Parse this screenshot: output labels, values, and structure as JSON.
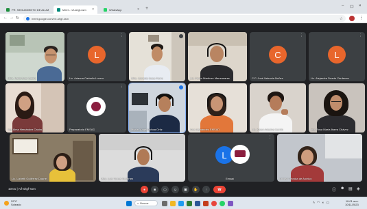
{
  "browser": {
    "tabs": [
      {
        "label": "PR. SEGUIMIENTO DE ALUM",
        "favicon_color": "#1e8e3e",
        "active": false
      },
      {
        "label": "Meet - rvf-ahgf-ssm",
        "favicon_color": "#00897b",
        "active": true
      },
      {
        "label": "WhatsApp",
        "favicon_color": "#25d366",
        "active": false
      }
    ],
    "url": "meet.google.com/rvf-ahgf-ssm"
  },
  "participants": [
    {
      "name": "Mtra. Karla Díaz Castro",
      "type": "video"
    },
    {
      "name": "Lic. Arianna Carballo Lucero",
      "type": "avatar",
      "initial": "L",
      "color": "#e8662c"
    },
    {
      "name": "Mtro. Gerardo Sosa Fierro",
      "type": "video"
    },
    {
      "name": "Lic. Pedro Martínez Manzanares",
      "type": "video"
    },
    {
      "name": "C.P. José Valencia Nuñez",
      "type": "avatar",
      "initial": "C",
      "color": "#e8662c"
    },
    {
      "name": "Lic. Alejandra Duarte Cárdenas",
      "type": "avatar",
      "initial": "L",
      "color": "#e8662c"
    },
    {
      "name": "Ing. Alma Hernández Castro",
      "type": "video"
    },
    {
      "name": "Preparatoria EMSAD",
      "type": "logo"
    },
    {
      "name": "Miguel Ángel Ochoa Ortiz",
      "type": "video"
    },
    {
      "name": "Ana Hernández EMSAD",
      "type": "video"
    },
    {
      "name": "Lic. Karen Ariadna Carrillo",
      "type": "video"
    },
    {
      "name": "Ing. Rosa María Ibarra Chávez",
      "type": "video"
    },
    {
      "name": "Lic. Lizbeth Gutiérrez Duarte",
      "type": "video"
    },
    {
      "name": "Mtro. Luis Torres Gutiérrez",
      "type": "video"
    },
    {
      "name": "Emsad",
      "type": "avatar-logo",
      "initial": "L",
      "color": "#1a73e8"
    },
    {
      "name": "Unidad Técnica de Archivo",
      "type": "video"
    }
  ],
  "meeting": {
    "time_code": "10:01 | rvf-ahgf-ssm"
  },
  "controls": {
    "mic": "mic-off-icon",
    "cam": "camera-icon",
    "captions": "cc-icon",
    "hand": "hand-icon",
    "present": "present-icon",
    "emoji": "emoji-icon",
    "more": "more-icon",
    "hangup": "hangup-icon",
    "right": [
      "info-icon",
      "people-icon",
      "chat-icon",
      "activities-icon"
    ]
  },
  "taskbar": {
    "weather_temp": "29°C",
    "weather_desc": "Soleado",
    "search_label": "Buscar",
    "time": "10:01 a.m.",
    "date": "10/11/2023"
  }
}
